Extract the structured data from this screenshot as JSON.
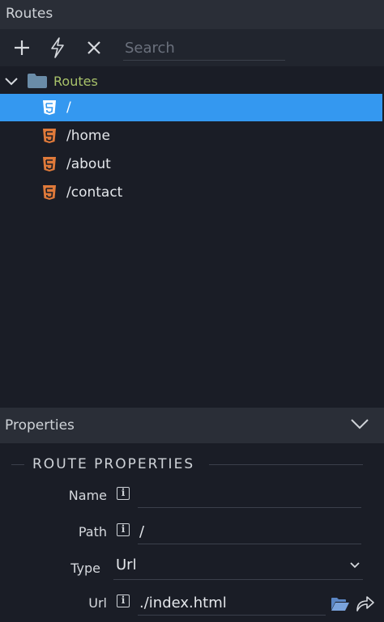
{
  "routes_panel": {
    "title": "Routes"
  },
  "toolbar": {
    "search_placeholder": "Search"
  },
  "tree": {
    "root_label": "Routes",
    "items": [
      {
        "label": "/",
        "selected": true
      },
      {
        "label": "/home",
        "selected": false
      },
      {
        "label": "/about",
        "selected": false
      },
      {
        "label": "/contact",
        "selected": false
      }
    ]
  },
  "properties_panel": {
    "title": "Properties",
    "section_title": "ROUTE PROPERTIES",
    "fields": {
      "name": {
        "label": "Name",
        "value": ""
      },
      "path": {
        "label": "Path",
        "value": "/"
      },
      "type": {
        "label": "Type",
        "value": "Url"
      },
      "url": {
        "label": "Url",
        "value": "./index.html"
      }
    }
  },
  "colors": {
    "selection": "#3498f0",
    "root_label": "#a8c26a",
    "html5_icon": "#e07a3a",
    "folder_icon": "#6a8ca8"
  }
}
